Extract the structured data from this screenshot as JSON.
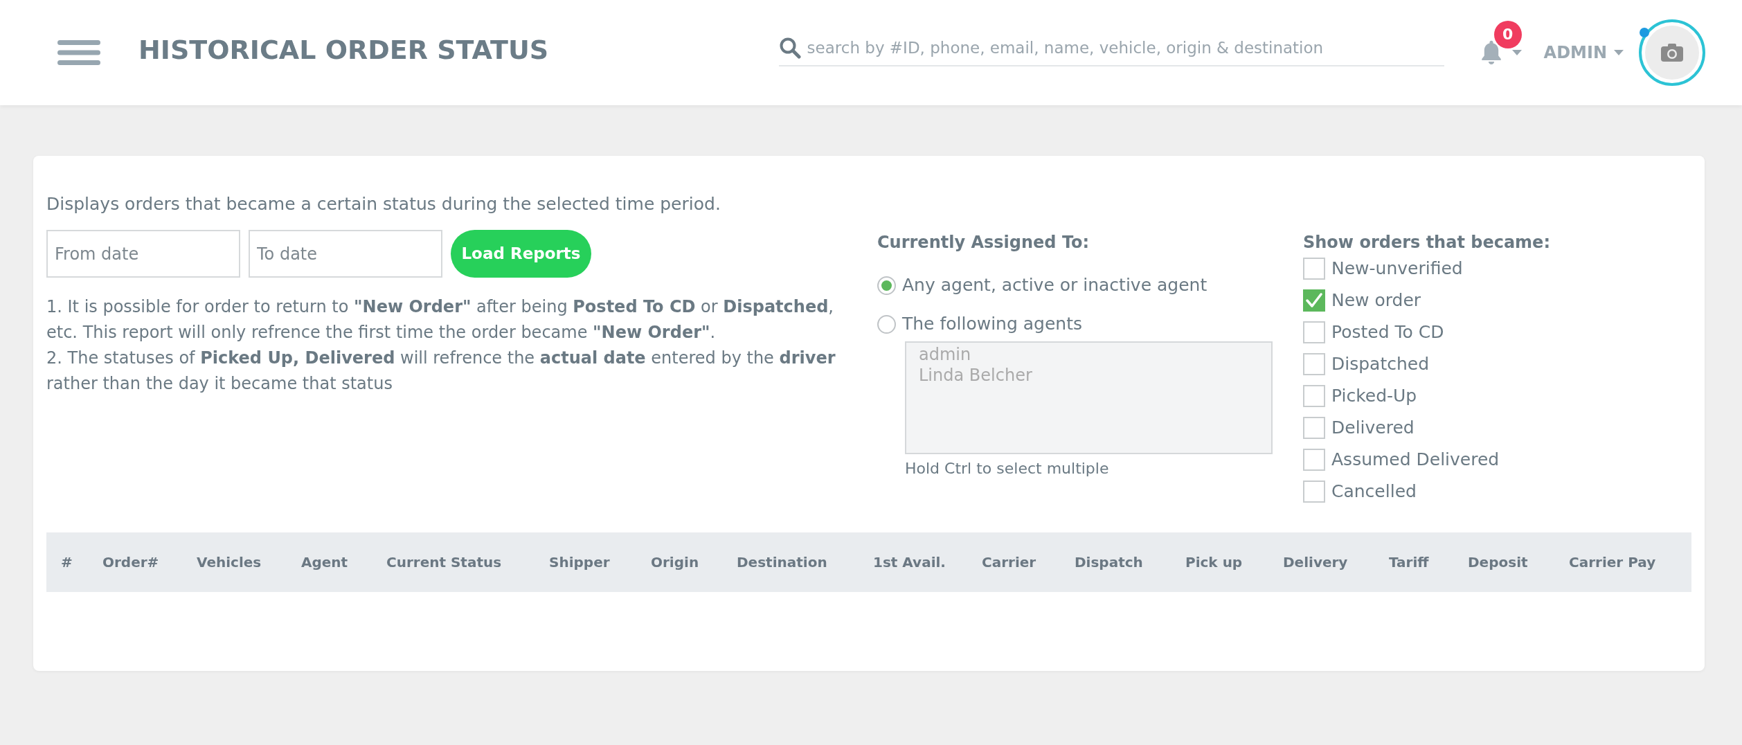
{
  "header": {
    "title": "HISTORICAL ORDER STATUS",
    "search": {
      "placeholder": "search by #ID, phone, email, name, vehicle, origin & destination"
    },
    "notifications": {
      "count": "0"
    },
    "user": {
      "name": "ADMIN",
      "online": true
    }
  },
  "filters": {
    "description": "Displays orders that became a certain status during the selected time period.",
    "from_date": {
      "placeholder": "From date"
    },
    "to_date": {
      "placeholder": "To date"
    },
    "load_button": "Load Reports",
    "notes": [
      "1. It is possible for order to return to **\"New Order\"** after being **Posted To CD** or **Dispatched**, etc. This report will only refrence the first time the order became **\"New Order\"**.",
      "2. The statuses of **Picked Up, Delivered** will refrence the **actual date** entered by the **driver** rather than the day it became that status"
    ]
  },
  "assigned_to": {
    "title": "Currently Assigned To:",
    "options": [
      {
        "label": "Any agent, active or inactive agent",
        "selected": true
      },
      {
        "label": "The following agents",
        "selected": false
      }
    ],
    "agents": {
      "disabled": true,
      "items": [
        {
          "name": "admin",
          "selected": false
        },
        {
          "name": "Linda Belcher",
          "selected": false
        }
      ]
    },
    "hint": "Hold Ctrl to select multiple"
  },
  "status_filter": {
    "title": "Show orders that became:",
    "items": [
      {
        "label": "New-unverified",
        "checked": false
      },
      {
        "label": "New order",
        "checked": true
      },
      {
        "label": "Posted To CD",
        "checked": false
      },
      {
        "label": "Dispatched",
        "checked": false
      },
      {
        "label": "Picked-Up",
        "checked": false
      },
      {
        "label": "Delivered",
        "checked": false
      },
      {
        "label": "Assumed Delivered",
        "checked": false
      },
      {
        "label": "Cancelled",
        "checked": false
      }
    ]
  },
  "table": {
    "columns": [
      "#",
      "Order#",
      "Vehicles",
      "Agent",
      "Current Status",
      "Shipper",
      "Origin",
      "Destination",
      "1st Avail.",
      "Carrier",
      "Dispatch",
      "Pick up",
      "Delivery",
      "Tariff",
      "Deposit",
      "Carrier Pay"
    ]
  }
}
